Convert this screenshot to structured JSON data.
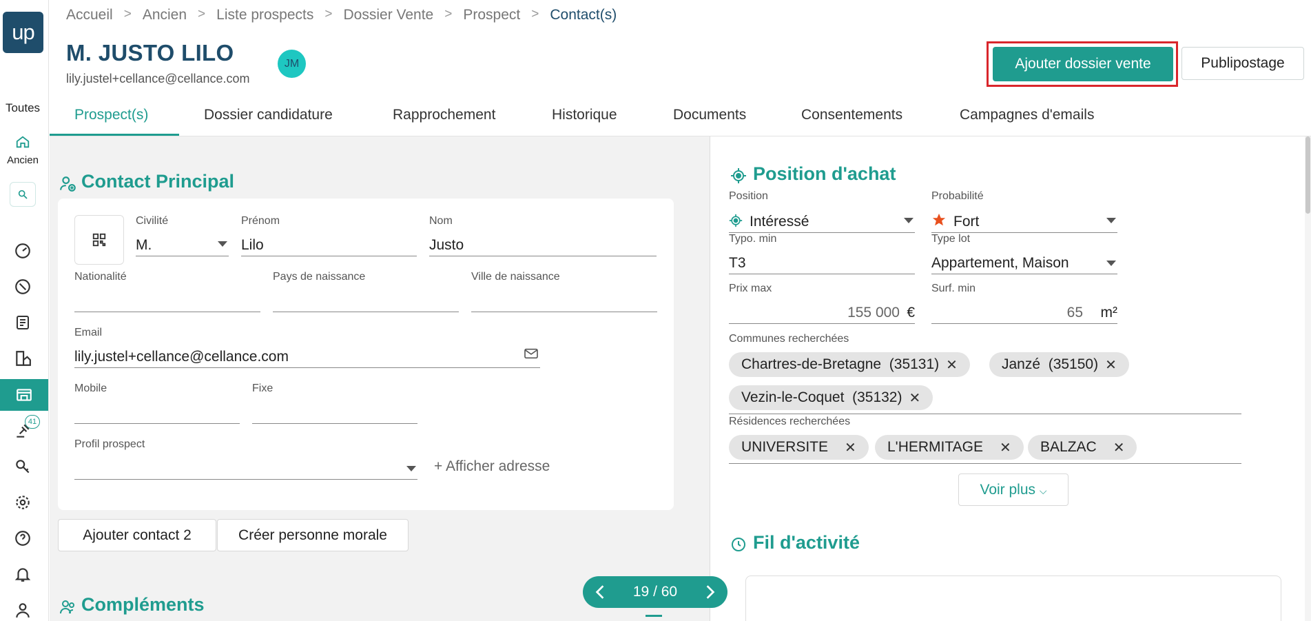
{
  "sidebar": {
    "logo": "up",
    "toutes_label": "Toutes",
    "home_label": "Ancien",
    "badge_count": "41"
  },
  "breadcrumb": [
    "Accueil",
    "Ancien",
    "Liste prospects",
    "Dossier Vente",
    "Prospect",
    "Contact(s)"
  ],
  "header": {
    "title": "M. JUSTO LILO",
    "email": "lily.justel+cellance@cellance.com",
    "avatar_initials": "JM",
    "primary_button": "Ajouter dossier vente",
    "secondary_button": "Publipostage"
  },
  "tabs": [
    "Prospect(s)",
    "Dossier candidature",
    "Rapprochement",
    "Historique",
    "Documents",
    "Consentements",
    "Campagnes d'emails"
  ],
  "contact": {
    "section_title": "Contact Principal",
    "civilite_label": "Civilité",
    "civilite_value": "M.",
    "prenom_label": "Prénom",
    "prenom_value": "Lilo",
    "nom_label": "Nom",
    "nom_value": "Justo",
    "nationalite_label": "Nationalité",
    "pays_label": "Pays de naissance",
    "ville_label": "Ville de naissance",
    "email_label": "Email",
    "email_value": "lily.justel+cellance@cellance.com",
    "mobile_label": "Mobile",
    "fixe_label": "Fixe",
    "profil_label": "Profil prospect",
    "afficher_adresse": "+ Afficher adresse",
    "btn_contact2": "Ajouter contact 2",
    "btn_personne_morale": "Créer personne morale"
  },
  "complements_title": "Compléments",
  "pager": {
    "text": "19 / 60"
  },
  "achat": {
    "section_title": "Position d'achat",
    "position_label": "Position",
    "position_value": "Intéressé",
    "probabilite_label": "Probabilité",
    "probabilite_value": "Fort",
    "typo_label": "Typo. min",
    "typo_value": "T3",
    "type_lot_label": "Type lot",
    "type_lot_value": "Appartement, Maison",
    "prix_label": "Prix max",
    "prix_value": "155 000",
    "prix_unit": "€",
    "surf_label": "Surf. min",
    "surf_value": "65",
    "surf_unit": "m²",
    "communes_label": "Communes recherchées",
    "communes": [
      "Chartres-de-Bretagne  (35131)",
      "Janzé  (35150)",
      "Vezin-le-Coquet  (35132)"
    ],
    "residences_label": "Résidences recherchées",
    "residences": [
      "UNIVERSITE",
      "L'HERMITAGE",
      "BALZAC"
    ],
    "voir_plus": "Voir plus"
  },
  "activite_title": "Fil d'activité",
  "colors": {
    "accent": "#1f9c8f",
    "navy": "#1f4d6b",
    "highlight": "#d9262c",
    "star": "#e8501e"
  }
}
